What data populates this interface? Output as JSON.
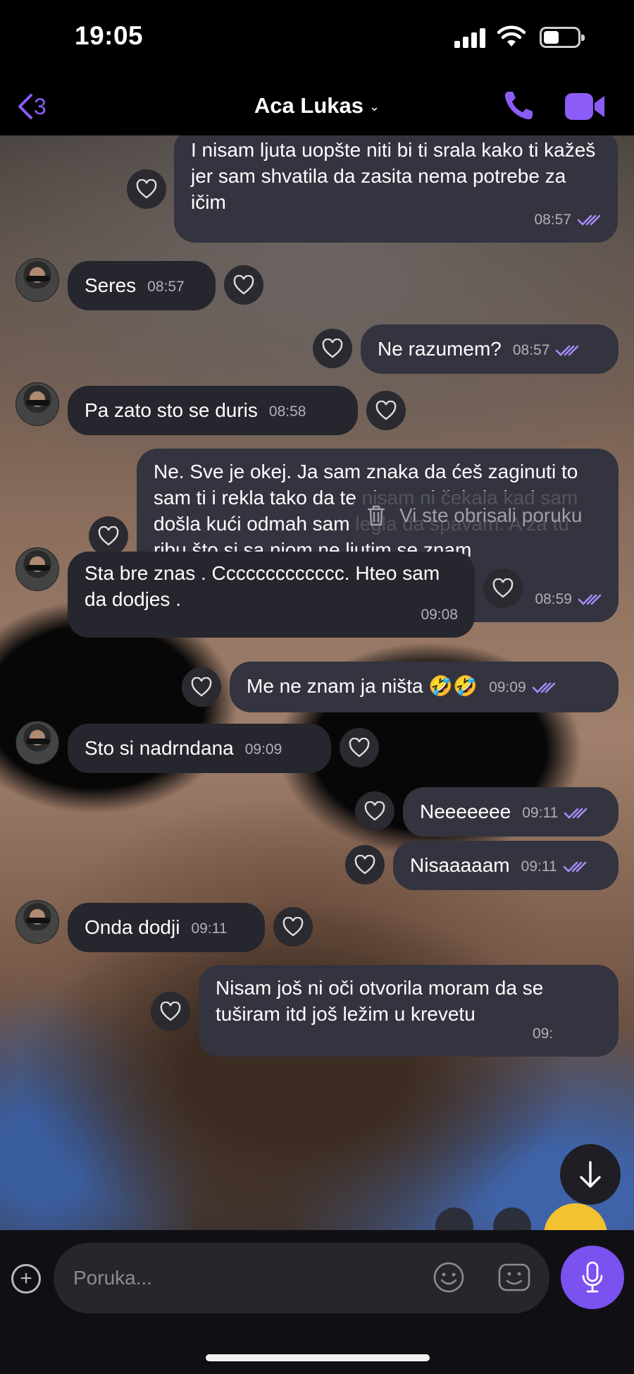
{
  "status_bar": {
    "time": "19:05",
    "battery_level": 0.45
  },
  "header": {
    "back_count": "3",
    "contact_name": "Aca Lukas",
    "chevron": "⌄",
    "accent_color": "#8b5cf6",
    "icons": {
      "back": "chevron-left-icon",
      "call": "phone-icon",
      "video": "video-camera-icon"
    }
  },
  "messages": [
    {
      "dir": "out",
      "text": "I nisam ljuta uopšte niti bi ti srala kako ti kažeš jer sam shvatila da zasita nema potrebe za ičim",
      "time": "08:57",
      "read": true
    },
    {
      "dir": "in",
      "text": "Seres",
      "time": "08:57"
    },
    {
      "dir": "out",
      "text": "Ne razumem?",
      "time": "08:57",
      "read": true
    },
    {
      "dir": "in",
      "text": "Pa zato sto se duris",
      "time": "08:58"
    },
    {
      "dir": "out",
      "text": "Ne. Sve je okej. Ja sam znaka da ćeš zaginuti to sam ti i rekla tako da te nisam ni čekala kad sam došla kući odmah sam legla da spavam. A za tu ribu što si sa njom ne ljutim se znam",
      "time": "08:59",
      "read": true
    },
    {
      "dir": "in",
      "text": "Sta bre znas . Ccccccccccccc. Hteo sam da dodjes .",
      "time": "09:08"
    },
    {
      "dir": "out",
      "text": "Me ne znam ja ništa 🤣🤣",
      "time": "09:09",
      "read": true
    },
    {
      "dir": "in",
      "text": "Sto si nadrndana",
      "time": "09:09"
    },
    {
      "dir": "out",
      "text": "Neeeeeee",
      "time": "09:11",
      "read": true
    },
    {
      "dir": "out",
      "text": "Nisaaaaam",
      "time": "09:11",
      "read": true
    },
    {
      "dir": "in",
      "text": "Onda dodji",
      "time": "09:11"
    },
    {
      "dir": "out",
      "text": "Nisam još ni oči otvorila moram da se tuširam itd još ležim u krevetu",
      "time": "09:",
      "read": true
    }
  ],
  "deleted_notice": "Vi ste obrisali poruku",
  "composer": {
    "placeholder": "Poruka..."
  },
  "colors": {
    "incoming_bubble": "#26262e",
    "outgoing_bubble": "#33343f",
    "mic_button": "#7b52f0"
  }
}
